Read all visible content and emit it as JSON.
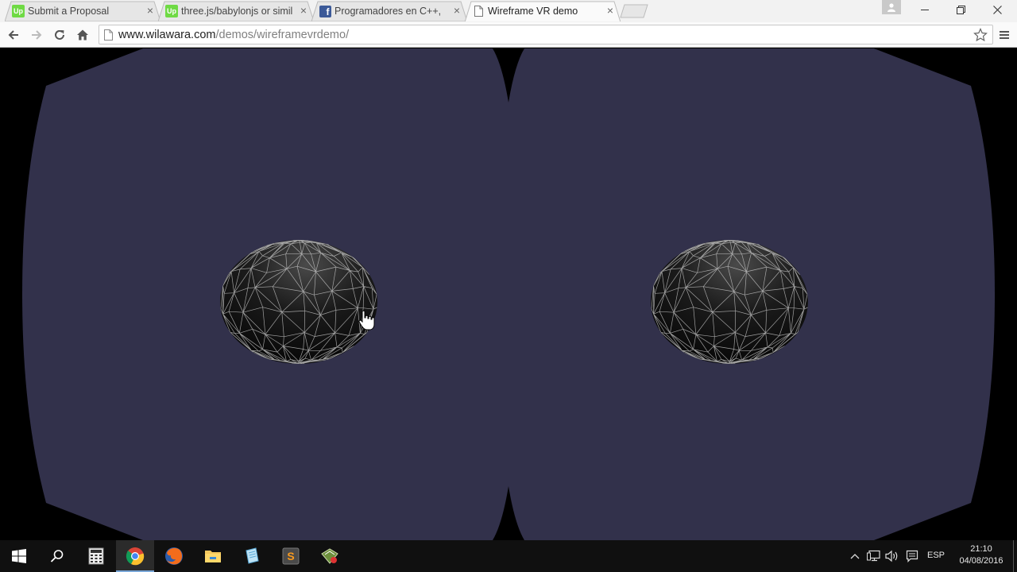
{
  "browser": {
    "tabs": [
      {
        "title": "Submit a Proposal",
        "favicon": "upwork-icon",
        "active": false
      },
      {
        "title": "three.js/babylonjs or simil",
        "favicon": "upwork-icon",
        "active": false
      },
      {
        "title": "Programadores en C++, ",
        "favicon": "facebook-icon",
        "active": false
      },
      {
        "title": "Wireframe VR demo",
        "favicon": "page-icon",
        "active": true
      }
    ],
    "close_glyph": "×",
    "favicon_up_text": "Up",
    "favicon_fb_text": "f",
    "url": {
      "host": "www.wilawara.com",
      "path": "/demos/wireframevrdemo/"
    }
  },
  "scene": {
    "background_color": "#000000",
    "lens_color": "#32314b",
    "sphere_color": "#1a1a1a",
    "wire_color": "#cfcfcf"
  },
  "taskbar": {
    "apps": [
      "start-icon",
      "search-icon",
      "calculator-icon",
      "chrome-icon",
      "firefox-icon",
      "file-explorer-icon",
      "notepad-icon",
      "sublime-text-icon",
      "app-icon"
    ],
    "sublime_letter": "S",
    "language": "ESP",
    "time": "21:10",
    "date": "04/08/2016"
  }
}
